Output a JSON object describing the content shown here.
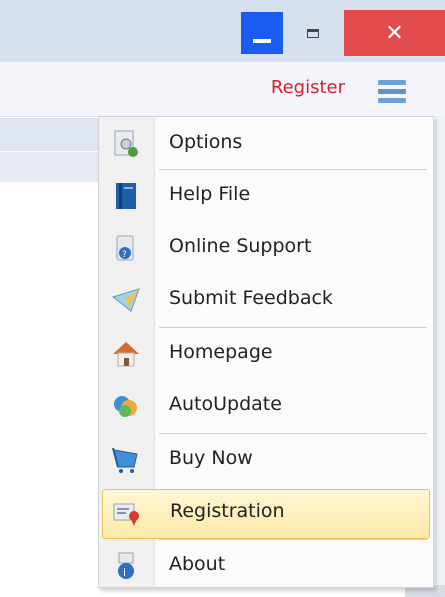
{
  "toolbar": {
    "register_label": "Register"
  },
  "window_controls": {
    "close_glyph": "✕"
  },
  "menu": {
    "items": [
      {
        "label": "Options",
        "icon": "options-icon"
      },
      {
        "label": "Help File",
        "icon": "help-file-icon"
      },
      {
        "label": "Online Support",
        "icon": "online-support-icon"
      },
      {
        "label": "Submit Feedback",
        "icon": "feedback-icon"
      },
      {
        "label": "Homepage",
        "icon": "home-icon"
      },
      {
        "label": "AutoUpdate",
        "icon": "autoupdate-icon"
      },
      {
        "label": "Buy Now",
        "icon": "cart-icon"
      },
      {
        "label": "Registration",
        "icon": "registration-icon",
        "highlighted": true
      },
      {
        "label": "About",
        "icon": "about-icon"
      }
    ]
  },
  "colors": {
    "accent": "#1a5cf0",
    "close": "#e34c4c",
    "register": "#d4202a",
    "highlight": "#fde8a6"
  }
}
